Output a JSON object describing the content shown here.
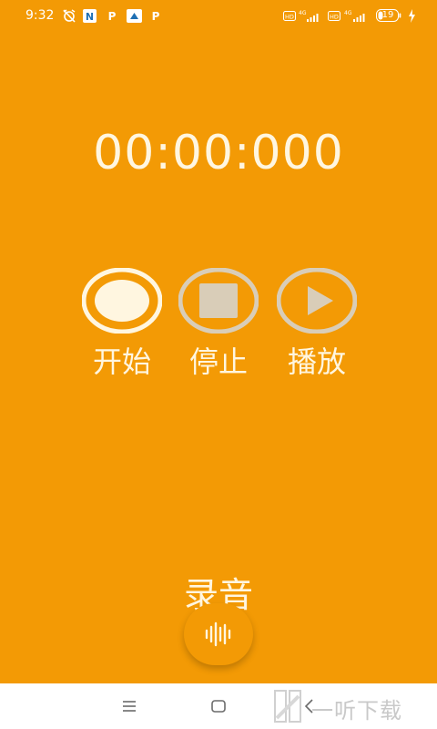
{
  "status_bar": {
    "time": "9:32",
    "battery": "19",
    "icons": [
      "alarm-off-icon",
      "n-app-icon",
      "p-app-icon",
      "cloud-app-icon",
      "p-app-icon",
      "hd-icon",
      "4g-signal-icon",
      "hd-icon",
      "4g-signal-icon",
      "battery-icon",
      "charging-icon"
    ]
  },
  "timer": {
    "value": "00:00:000"
  },
  "controls": {
    "start_label": "开始",
    "stop_label": "停止",
    "play_label": "播放"
  },
  "record": {
    "label": "录音"
  },
  "nav_bar": {
    "icons": [
      "menu-icon",
      "home-icon",
      "back-icon"
    ]
  },
  "watermark": {
    "text": "一听下载"
  },
  "colors": {
    "background": "#F39A05",
    "foreground": "#FFF6E0",
    "disabled": "#D9CDB8",
    "nav_background": "#FFFFFF"
  }
}
